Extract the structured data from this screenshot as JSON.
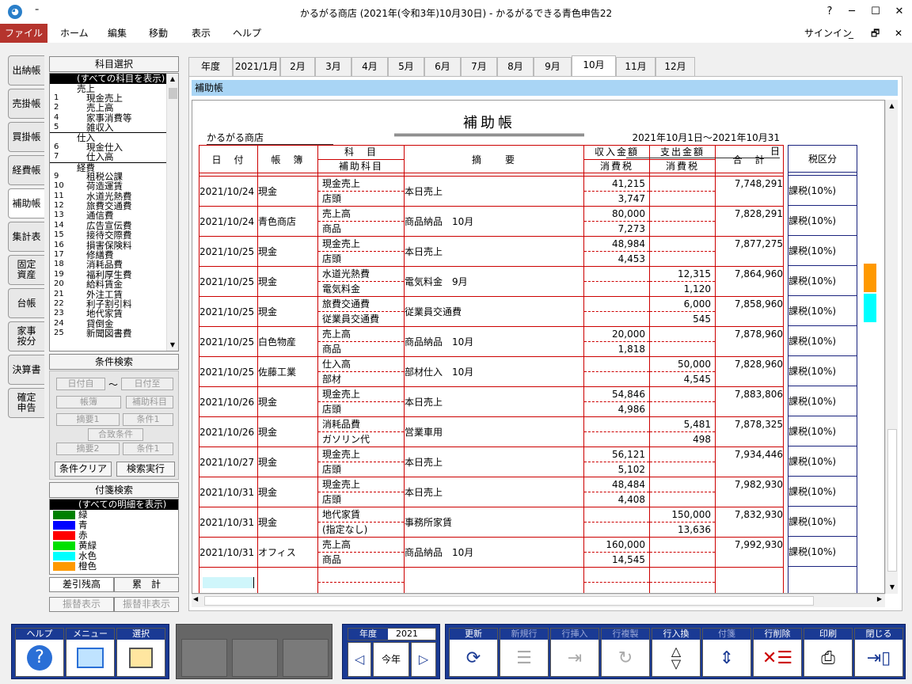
{
  "window": {
    "title": "かるがる商店 (2021年(令和3年)10月30日) - かるがるできる青色申告22",
    "qa": "₌",
    "help": "?",
    "minimize": "─",
    "maximize": "☐",
    "close": "✕"
  },
  "menu": {
    "file": "ファイル",
    "home": "ホーム",
    "edit": "編集",
    "move": "移動",
    "view": "表示",
    "help": "ヘルプ",
    "signin": "サインイン",
    "min": "_",
    "restore": "🗗",
    "close": "✕"
  },
  "left_tabs": [
    "出納帳",
    "売掛帳",
    "買掛帳",
    "経費帳",
    "補助帳",
    "集計表",
    "固定\n資産",
    "台帳",
    "家事\n按分",
    "決算書",
    "確定\n申告"
  ],
  "kamoku": {
    "heading": "科目選択",
    "items": [
      {
        "n": "",
        "t": "(すべての科目を表示)",
        "kind": "sel"
      },
      {
        "n": "",
        "t": "売上",
        "kind": "grp"
      },
      {
        "n": "1",
        "t": "現金売上"
      },
      {
        "n": "2",
        "t": "売上高"
      },
      {
        "n": "4",
        "t": "家事消費等"
      },
      {
        "n": "5",
        "t": "雑収入"
      },
      {
        "n": "",
        "t": "仕入",
        "kind": "grp"
      },
      {
        "n": "6",
        "t": "現金仕入"
      },
      {
        "n": "7",
        "t": "仕入高"
      },
      {
        "n": "",
        "t": "経費",
        "kind": "grp"
      },
      {
        "n": "9",
        "t": "租税公課"
      },
      {
        "n": "10",
        "t": "荷造運賃"
      },
      {
        "n": "11",
        "t": "水道光熱費"
      },
      {
        "n": "12",
        "t": "旅費交通費"
      },
      {
        "n": "13",
        "t": "通信費"
      },
      {
        "n": "14",
        "t": "広告宣伝費"
      },
      {
        "n": "15",
        "t": "接待交際費"
      },
      {
        "n": "16",
        "t": "損害保険料"
      },
      {
        "n": "17",
        "t": "修繕費"
      },
      {
        "n": "18",
        "t": "消耗品費"
      },
      {
        "n": "19",
        "t": "福利厚生費"
      },
      {
        "n": "20",
        "t": "給料賃金"
      },
      {
        "n": "21",
        "t": "外注工賃"
      },
      {
        "n": "22",
        "t": "利子割引料"
      },
      {
        "n": "23",
        "t": "地代家賃"
      },
      {
        "n": "24",
        "t": "貸倒金"
      },
      {
        "n": "25",
        "t": "新聞図書費"
      }
    ]
  },
  "cond": {
    "heading": "条件検索",
    "date_from": "日付自",
    "tilde": "〜",
    "date_to": "日付至",
    "book": "帳簿",
    "sub": "補助科目",
    "memo1": "摘要1",
    "c1": "条件1",
    "match": "合致条件",
    "memo2": "摘要2",
    "c2": "条件1",
    "clear": "条件クリア",
    "search": "検索実行"
  },
  "fusen": {
    "heading": "付箋検索",
    "items": [
      {
        "t": "(すべての明細を表示)",
        "c": ""
      },
      {
        "t": "緑",
        "c": "#008000"
      },
      {
        "t": "青",
        "c": "#0000ff"
      },
      {
        "t": "赤",
        "c": "#ff0000"
      },
      {
        "t": "黄緑",
        "c": "#00e000"
      },
      {
        "t": "水色",
        "c": "#00ffff"
      },
      {
        "t": "橙色",
        "c": "#ff9900"
      }
    ],
    "sashihiki": "差引残高",
    "ruikei": "累　計",
    "furikae_show": "振替表示",
    "furikae_hide": "振替非表示"
  },
  "month_tabs": [
    "年度",
    "2021/1月",
    "2月",
    "3月",
    "4月",
    "5月",
    "6月",
    "7月",
    "8月",
    "9月",
    "10月",
    "11月",
    "12月"
  ],
  "active_month": "10月",
  "subbar": "補助帳",
  "ledger": {
    "title": "補助帳",
    "shop": "かるがる商店",
    "period": "2021年10月1日〜2021年10月31日",
    "headers": {
      "date": "日　付",
      "book": "帳　簿",
      "kamoku": "科　目",
      "hojo": "補助科目",
      "memo": "摘　　要",
      "income": "収入金額",
      "income_tax": "消費税",
      "expense": "支出金額",
      "expense_tax": "消費税",
      "total": "合　計",
      "tax_class": "税区分"
    },
    "rows": [
      {
        "date": "2021/10/24",
        "book": "現金",
        "k1": "現金売上",
        "k2": "店頭",
        "memo": "本日売上",
        "inc": "41,215",
        "inc_tax": "3,747",
        "exp": "",
        "exp_tax": "",
        "total": "7,748,291",
        "tax": "課税(10%)"
      },
      {
        "date": "2021/10/24",
        "book": "青色商店",
        "k1": "売上高",
        "k2": "商品",
        "memo": "商品納品　10月",
        "inc": "80,000",
        "inc_tax": "7,273",
        "exp": "",
        "exp_tax": "",
        "total": "7,828,291",
        "tax": "課税(10%)"
      },
      {
        "date": "2021/10/25",
        "book": "現金",
        "k1": "現金売上",
        "k2": "店頭",
        "memo": "本日売上",
        "inc": "48,984",
        "inc_tax": "4,453",
        "exp": "",
        "exp_tax": "",
        "total": "7,877,275",
        "tax": "課税(10%)"
      },
      {
        "date": "2021/10/25",
        "book": "現金",
        "k1": "水道光熱費",
        "k2": "電気料金",
        "memo": "電気料金　9月",
        "inc": "",
        "inc_tax": "",
        "exp": "12,315",
        "exp_tax": "1,120",
        "total": "7,864,960",
        "tax": "課税(10%)"
      },
      {
        "date": "2021/10/25",
        "book": "現金",
        "k1": "旅費交通費",
        "k2": "従業員交通費",
        "memo": "従業員交通費",
        "inc": "",
        "inc_tax": "",
        "exp": "6,000",
        "exp_tax": "545",
        "total": "7,858,960",
        "tax": "課税(10%)"
      },
      {
        "date": "2021/10/25",
        "book": "白色物産",
        "k1": "売上高",
        "k2": "商品",
        "memo": "商品納品　10月",
        "inc": "20,000",
        "inc_tax": "1,818",
        "exp": "",
        "exp_tax": "",
        "total": "7,878,960",
        "tax": "課税(10%)"
      },
      {
        "date": "2021/10/25",
        "book": "佐藤工業",
        "k1": "仕入高",
        "k2": "部材",
        "memo": "部材仕入　10月",
        "inc": "",
        "inc_tax": "",
        "exp": "50,000",
        "exp_tax": "4,545",
        "total": "7,828,960",
        "tax": "課税(10%)"
      },
      {
        "date": "2021/10/26",
        "book": "現金",
        "k1": "現金売上",
        "k2": "店頭",
        "memo": "本日売上",
        "inc": "54,846",
        "inc_tax": "4,986",
        "exp": "",
        "exp_tax": "",
        "total": "7,883,806",
        "tax": "課税(10%)"
      },
      {
        "date": "2021/10/26",
        "book": "現金",
        "k1": "消耗品費",
        "k2": "ガソリン代",
        "memo": "営業車用",
        "inc": "",
        "inc_tax": "",
        "exp": "5,481",
        "exp_tax": "498",
        "total": "7,878,325",
        "tax": "課税(10%)"
      },
      {
        "date": "2021/10/27",
        "book": "現金",
        "k1": "現金売上",
        "k2": "店頭",
        "memo": "本日売上",
        "inc": "56,121",
        "inc_tax": "5,102",
        "exp": "",
        "exp_tax": "",
        "total": "7,934,446",
        "tax": "課税(10%)"
      },
      {
        "date": "2021/10/31",
        "book": "現金",
        "k1": "現金売上",
        "k2": "店頭",
        "memo": "本日売上",
        "inc": "48,484",
        "inc_tax": "4,408",
        "exp": "",
        "exp_tax": "",
        "total": "7,982,930",
        "tax": "課税(10%)"
      },
      {
        "date": "2021/10/31",
        "book": "現金",
        "k1": "地代家賃",
        "k2": "(指定なし)",
        "memo": "事務所家賃",
        "inc": "",
        "inc_tax": "",
        "exp": "150,000",
        "exp_tax": "13,636",
        "total": "7,832,930",
        "tax": "課税(10%)"
      },
      {
        "date": "2021/10/31",
        "book": "オフィス",
        "k1": "売上高",
        "k2": "商品",
        "memo": "商品納品　10月",
        "inc": "160,000",
        "inc_tax": "14,545",
        "exp": "",
        "exp_tax": "",
        "total": "7,992,930",
        "tax": "課税(10%)"
      }
    ],
    "markers": [
      {
        "color": "#ff9900"
      },
      {
        "color": "#00ffff"
      }
    ]
  },
  "bottom": {
    "help": "ヘルプ",
    "menu": "メニュー",
    "select": "選択",
    "year_label": "年度",
    "year": "2021",
    "this_year": "今年",
    "update": "更新",
    "newrow": "新規行",
    "insert": "行挿入",
    "copy": "行複製",
    "swap": "行入換",
    "fusen": "付箋",
    "delete": "行削除",
    "print": "印刷",
    "close": "閉じる"
  }
}
